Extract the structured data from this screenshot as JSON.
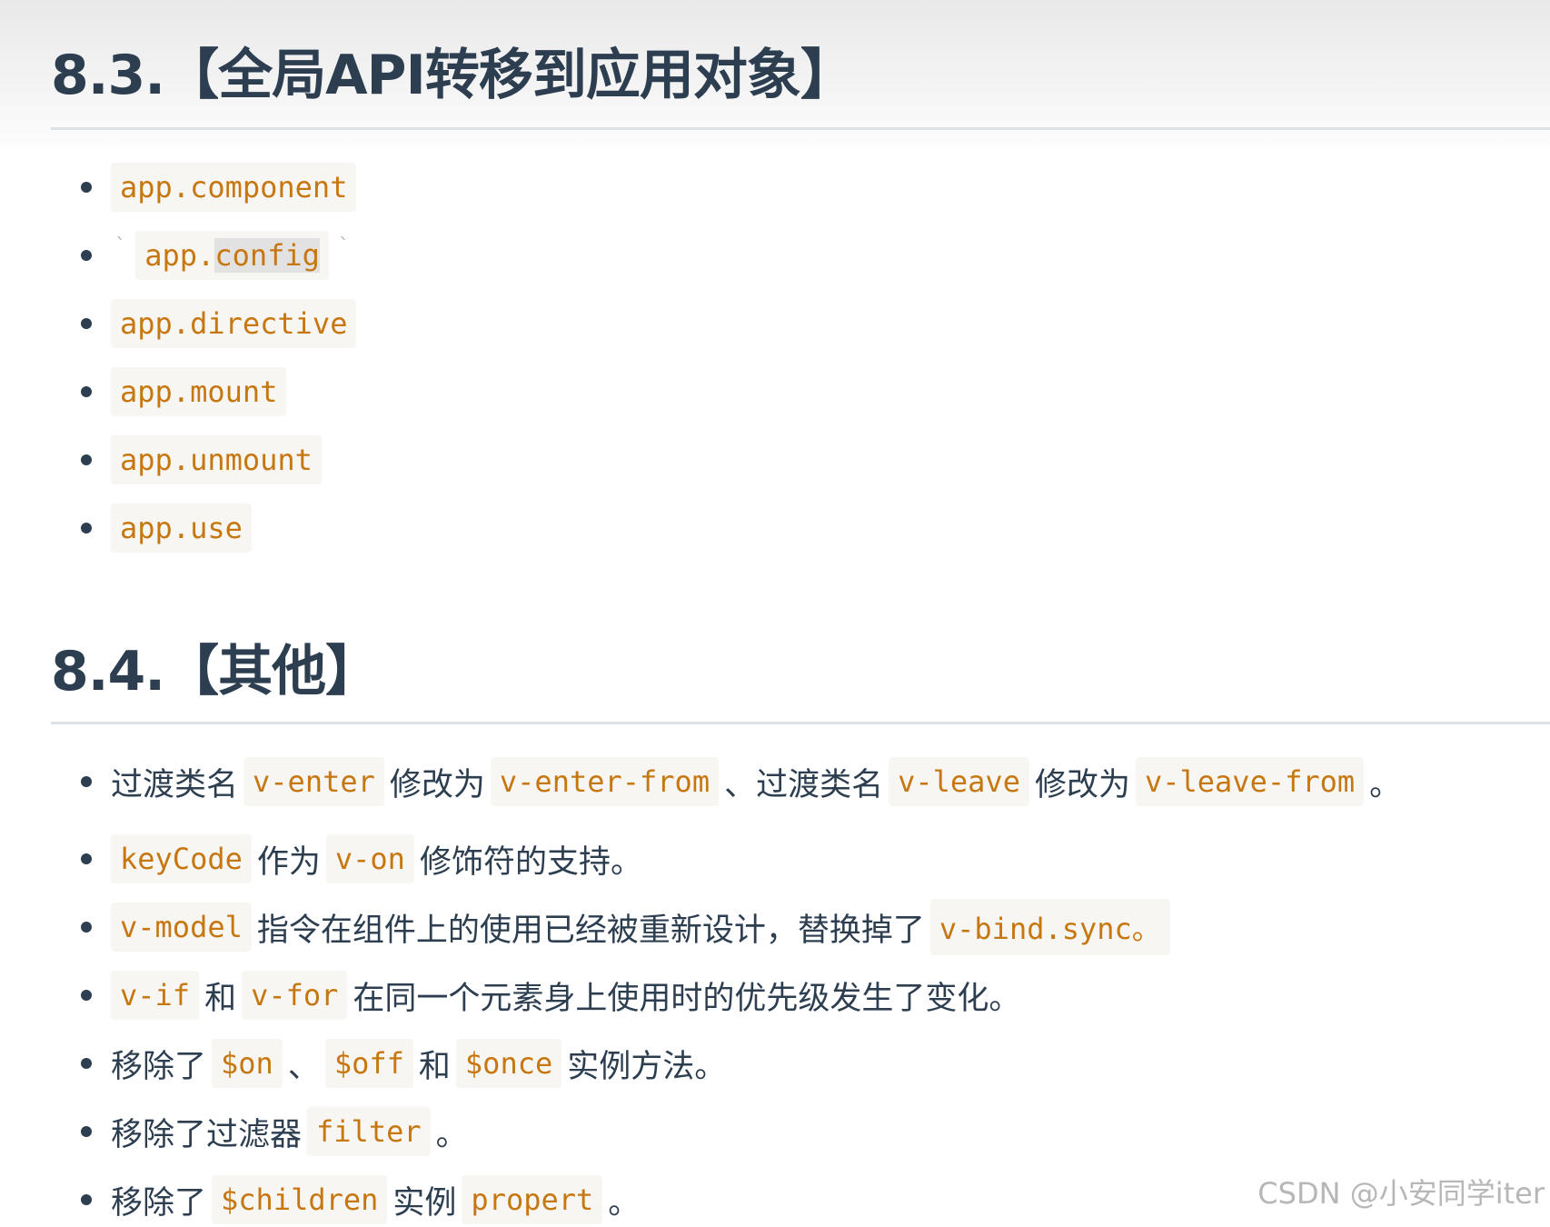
{
  "section_83": {
    "title": "8.3.【全局API转移到应用对象】",
    "items": [
      {
        "code": "app.component"
      },
      {
        "tick_before": "`",
        "code_prefix": "app.",
        "code_highlight": "config",
        "tick_after": "`"
      },
      {
        "code": "app.directive"
      },
      {
        "code": "app.mount"
      },
      {
        "code": "app.unmount"
      },
      {
        "code": "app.use"
      }
    ]
  },
  "section_84": {
    "title": "8.4.【其他】",
    "items": [
      {
        "t1": "过渡类名",
        "c1": "v-enter",
        "t2": "修改为",
        "c2": "v-enter-from",
        "t3": "、过渡类名",
        "c3": "v-leave",
        "t4": "修改为",
        "c4": "v-leave-from",
        "t5": "。"
      },
      {
        "c1": "keyCode",
        "t1": "作为",
        "c2": "v-on",
        "t2": "修饰符的支持。"
      },
      {
        "c1": "v-model",
        "t1": "指令在组件上的使用已经被重新设计，替换掉了",
        "c2": "v-bind.sync。"
      },
      {
        "c1": "v-if",
        "t1": "和",
        "c2": "v-for",
        "t2": "在同一个元素身上使用时的优先级发生了变化。"
      },
      {
        "t1": "移除了",
        "c1": "$on",
        "t2": "、",
        "c2": "$off",
        "t3": "和",
        "c3": "$once",
        "t4": "实例方法。"
      },
      {
        "t1": "移除了过滤器",
        "c1": "filter",
        "t2": "。"
      },
      {
        "t1": "移除了",
        "c1": "$children",
        "t2": "实例",
        "c2": "propert",
        "t3": "。"
      }
    ]
  },
  "watermark": "CSDN @小安同学iter",
  "colors": {
    "heading": "#2c3e50",
    "text": "#2c3e50",
    "code_text": "#c7770f",
    "code_bg": "#f7f6f3",
    "rule": "#dfe2e5"
  }
}
